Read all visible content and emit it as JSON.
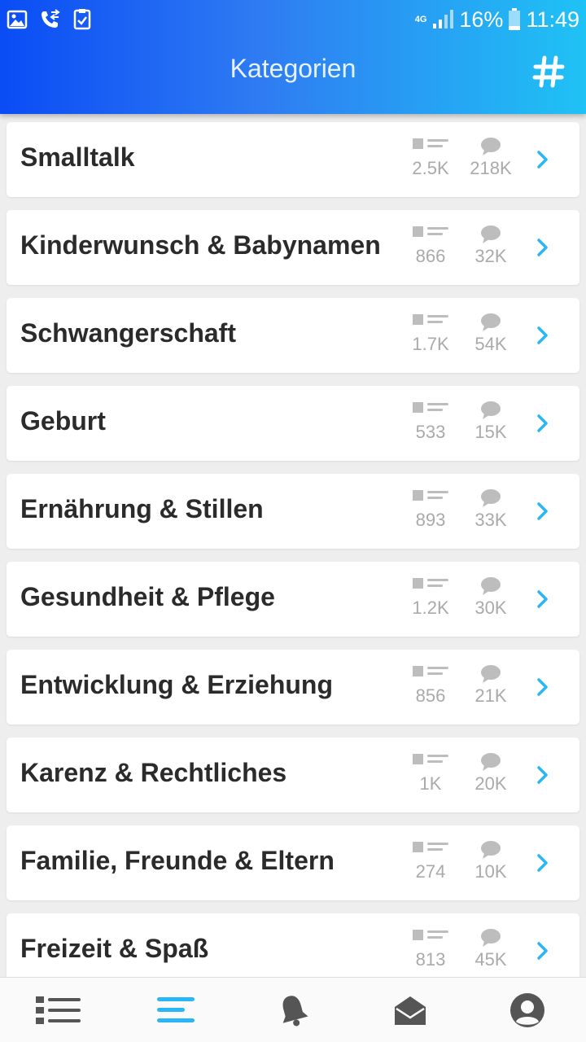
{
  "status_bar": {
    "network": "4G",
    "battery": "16%",
    "time": "11:49"
  },
  "header": {
    "title": "Kategorien",
    "hashtag_icon": "hashtag-icon"
  },
  "colors": {
    "header_start": "#0a4cf5",
    "header_end": "#1fc2f5",
    "accent": "#29b6f6",
    "stat_gray": "#aaaaaa",
    "text_dark": "#2b2b2b"
  },
  "categories": [
    {
      "name": "Smalltalk",
      "topics": "2.5K",
      "posts": "218K"
    },
    {
      "name": "Kinderwunsch & Babynamen",
      "topics": "866",
      "posts": "32K"
    },
    {
      "name": "Schwangerschaft",
      "topics": "1.7K",
      "posts": "54K"
    },
    {
      "name": "Geburt",
      "topics": "533",
      "posts": "15K"
    },
    {
      "name": "Ernährung & Stillen",
      "topics": "893",
      "posts": "33K"
    },
    {
      "name": "Gesundheit & Pflege",
      "topics": "1.2K",
      "posts": "30K"
    },
    {
      "name": "Entwicklung & Erziehung",
      "topics": "856",
      "posts": "21K"
    },
    {
      "name": "Karenz & Rechtliches",
      "topics": "1K",
      "posts": "20K"
    },
    {
      "name": "Familie, Freunde & Eltern",
      "topics": "274",
      "posts": "10K"
    },
    {
      "name": "Freizeit & Spaß",
      "topics": "813",
      "posts": "45K"
    }
  ],
  "bottom_nav": [
    {
      "icon": "list-icon",
      "active": false
    },
    {
      "icon": "categories-icon",
      "active": true
    },
    {
      "icon": "bell-icon",
      "active": false
    },
    {
      "icon": "mail-icon",
      "active": false
    },
    {
      "icon": "profile-icon",
      "active": false
    }
  ]
}
